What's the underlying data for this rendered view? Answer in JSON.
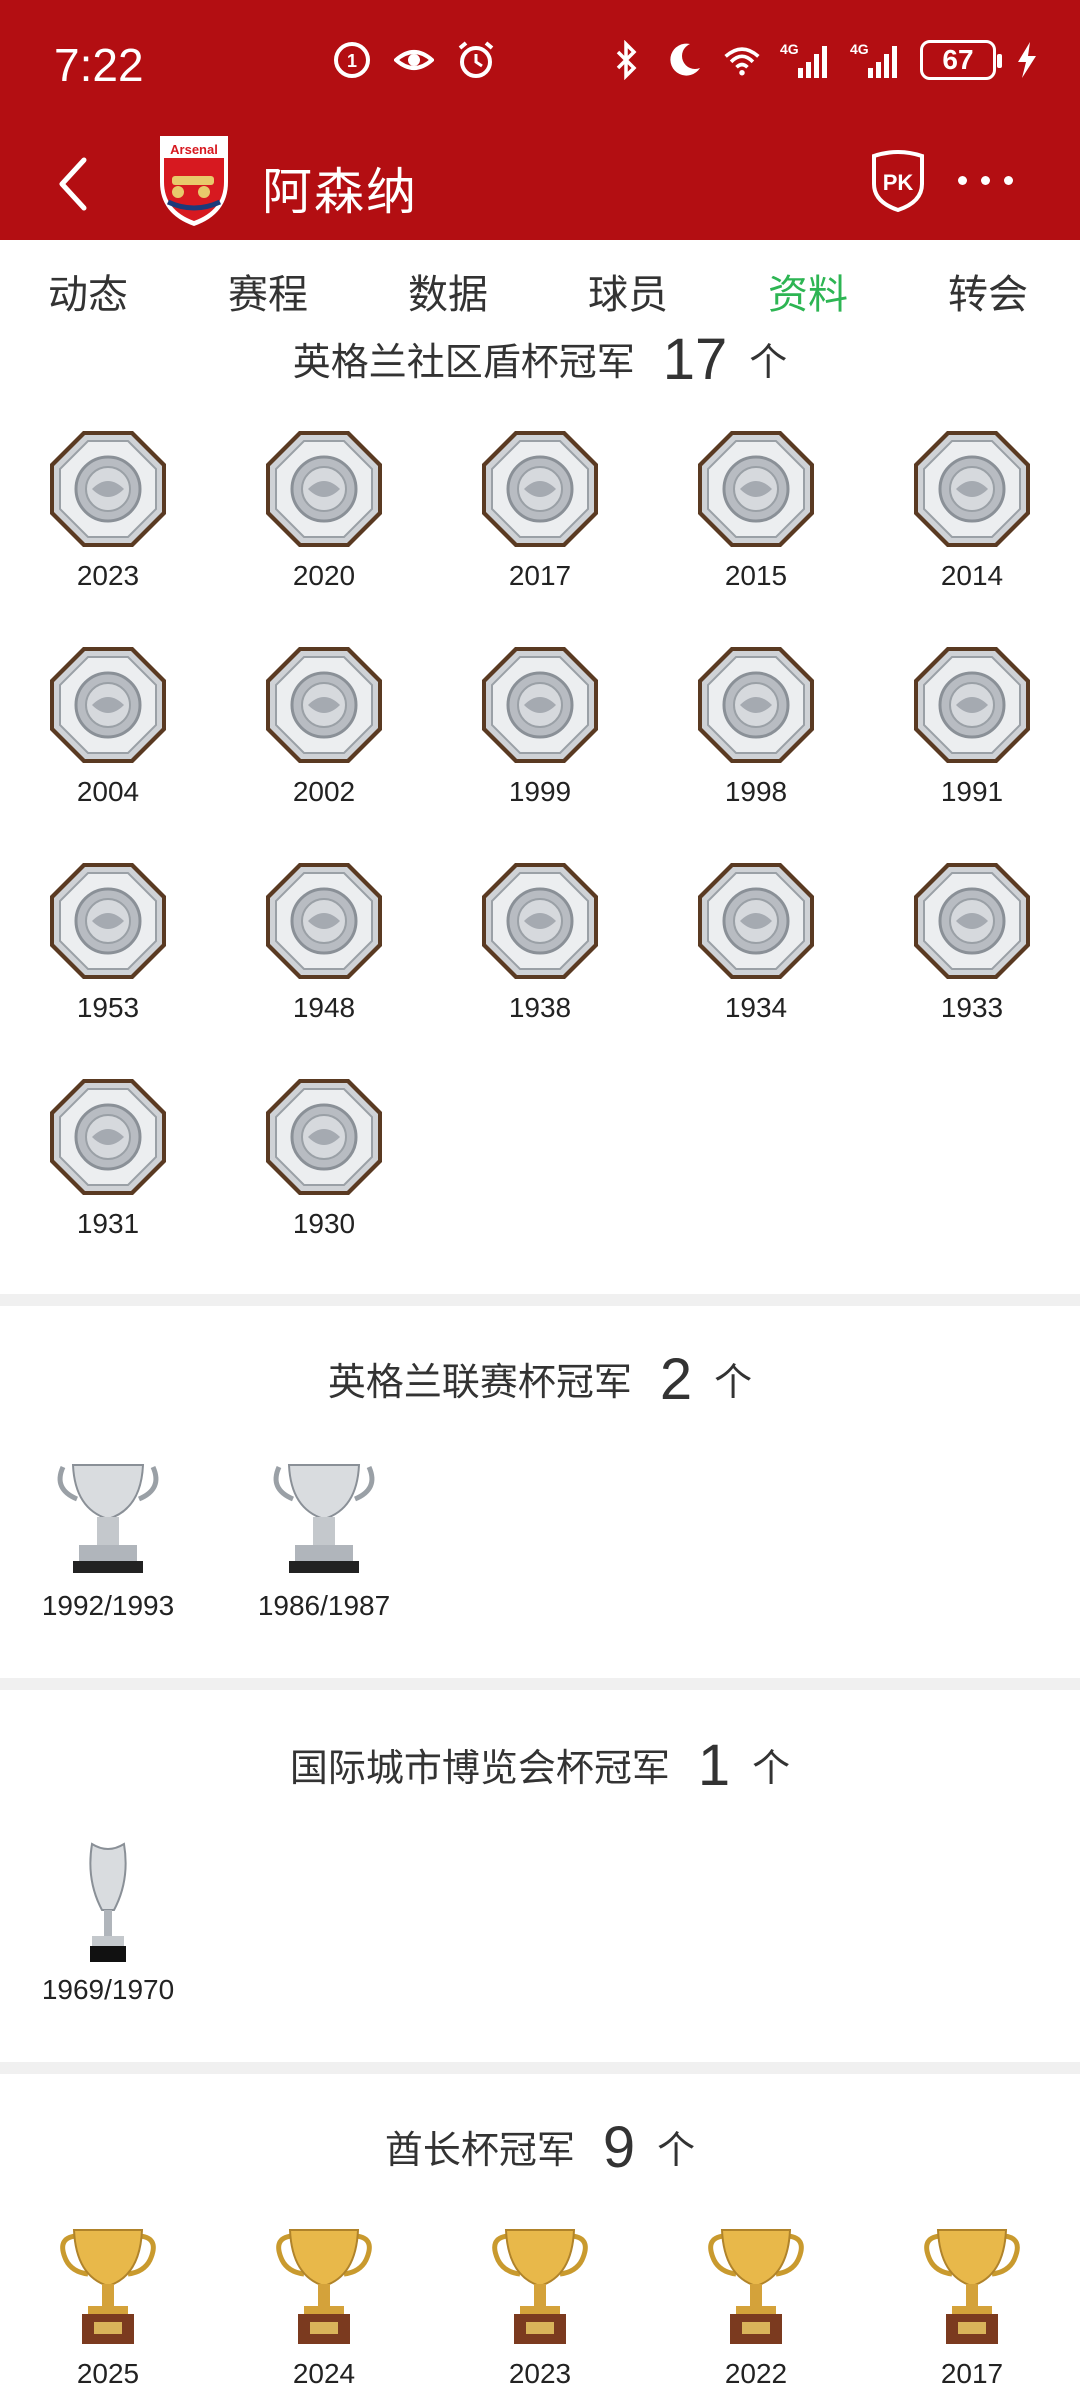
{
  "status_bar": {
    "time": "7:22",
    "battery": "67",
    "network_a": "4G",
    "network_b": "4G"
  },
  "app_bar": {
    "team_name": "阿森纳",
    "logo_text": "Arsenal",
    "pk_label": "PK"
  },
  "tabs": [
    {
      "label": "动态",
      "active": false
    },
    {
      "label": "赛程",
      "active": false
    },
    {
      "label": "数据",
      "active": false
    },
    {
      "label": "球员",
      "active": false
    },
    {
      "label": "资料",
      "active": true
    },
    {
      "label": "转会",
      "active": false
    }
  ],
  "sections": [
    {
      "title": "英格兰社区盾杯冠军",
      "count": "17",
      "unit": "个",
      "trophy_icon": "community-shield-icon",
      "years": [
        "2023",
        "2020",
        "2017",
        "2015",
        "2014",
        "2004",
        "2002",
        "1999",
        "1998",
        "1991",
        "1953",
        "1948",
        "1938",
        "1934",
        "1933",
        "1931",
        "1930"
      ]
    },
    {
      "title": "英格兰联赛杯冠军",
      "count": "2",
      "unit": "个",
      "trophy_icon": "league-cup-icon",
      "years": [
        "1992/1993",
        "1986/1987"
      ]
    },
    {
      "title": "国际城市博览会杯冠军",
      "count": "1",
      "unit": "个",
      "trophy_icon": "fairs-cup-icon",
      "years": [
        "1969/1970"
      ]
    },
    {
      "title": "酋长杯冠军",
      "count": "9",
      "unit": "个",
      "trophy_icon": "gold-cup-icon",
      "years": [
        "2025",
        "2024",
        "2023",
        "2022",
        "2017"
      ]
    }
  ],
  "colors": {
    "header_bg": "#b30e12",
    "active_tab": "#2db553"
  }
}
